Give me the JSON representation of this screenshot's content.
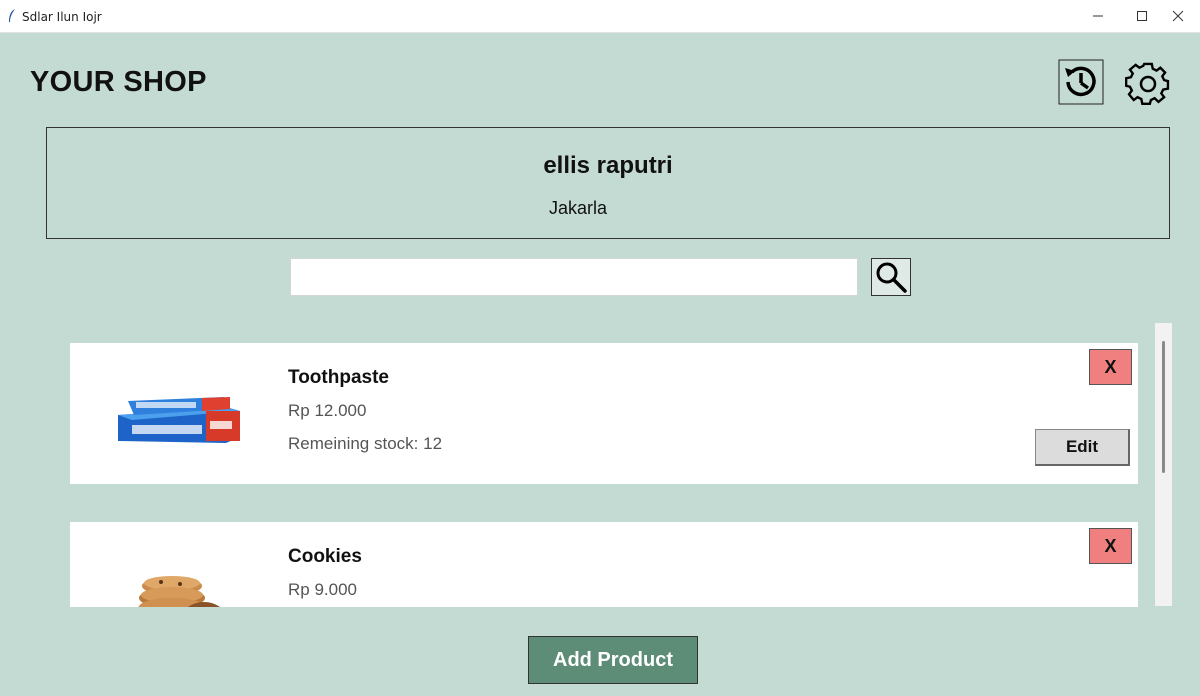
{
  "window": {
    "title": "Sdlar Ilun Iojr",
    "minimize_glyph": "—",
    "maximize_glyph": "☐",
    "close_glyph": "✕"
  },
  "header": {
    "title": "YOUR SHOP",
    "history_icon": "history-icon",
    "settings_icon": "gear-icon"
  },
  "profile": {
    "name": "ellis raputri",
    "city": "Jakarla"
  },
  "search": {
    "value": "",
    "placeholder": "",
    "icon": "search-icon"
  },
  "products": [
    {
      "name": "Toothpaste",
      "price": "Rp 12.000",
      "stock": "Remeining stock: 12",
      "delete_label": "X",
      "edit_label": "Edit",
      "image": "toothpaste-image"
    },
    {
      "name": "Cookies",
      "price": "Rp 9.000",
      "delete_label": "X",
      "image": "cookies-image"
    }
  ],
  "add_button_label": "Add Product",
  "colors": {
    "background": "#c4dbd3",
    "delete_button": "#f08080",
    "add_button": "#5d8c77",
    "edit_button": "#dcdcdc"
  }
}
